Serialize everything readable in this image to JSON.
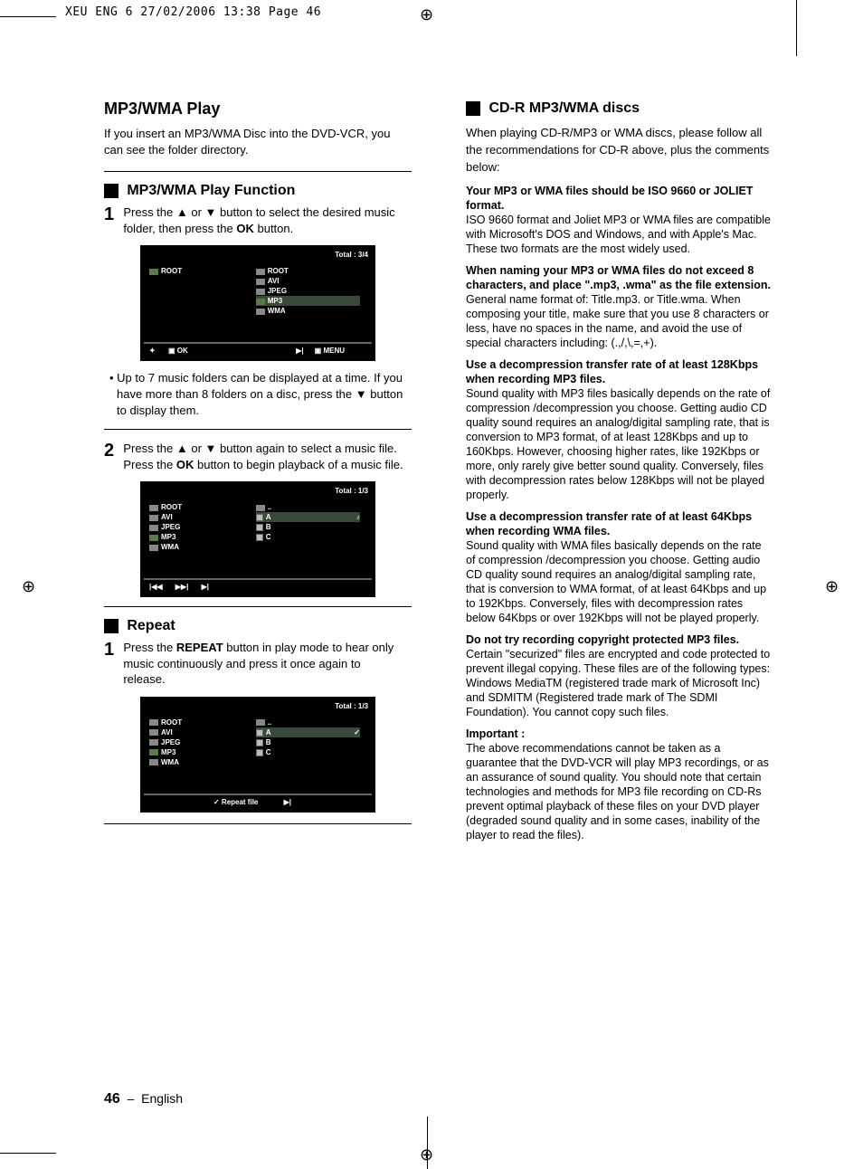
{
  "header": {
    "text": "XEU ENG 6  27/02/2006  13:38  Page 46"
  },
  "left": {
    "title": "MP3/WMA Play",
    "intro": "If you insert an MP3/WMA Disc into the DVD-VCR, you can see the folder directory.",
    "section1": {
      "title": "MP3/WMA Play Function",
      "step1_a": "Press the ▲ or ▼ button to select the desired music folder, then press the ",
      "step1_ok": "OK",
      "step1_b": " button.",
      "bullet": "• Up to 7 music folders can be displayed at a time. If you have more than 8 folders on a disc, press the ▼ button to display them.",
      "step2_a": "Press the ▲ or ▼ button again to select a music file. Press the ",
      "step2_ok": "OK",
      "step2_b": " button to begin playback of a music file."
    },
    "section2": {
      "title": "Repeat",
      "step1_a": "Press the ",
      "step1_repeat": "REPEAT",
      "step1_b": " button in play mode to hear only music continuously and press it once again to release."
    },
    "osd1": {
      "total": "Total : 3/4",
      "left_items": [
        "ROOT"
      ],
      "right_items": [
        "ROOT",
        "AVI",
        "JPEG",
        "MP3",
        "WMA"
      ],
      "selected": "MP3",
      "footer": {
        "ok": "OK",
        "menu": "MENU"
      }
    },
    "osd2": {
      "total": "Total : 1/3",
      "left_items": [
        "ROOT",
        "AVI",
        "JPEG",
        "MP3",
        "WMA"
      ],
      "left_sel": "MP3",
      "right_items": [
        "..",
        "A",
        "B",
        "C"
      ],
      "right_sel": "A"
    },
    "osd3": {
      "total": "Total : 1/3",
      "left_items": [
        "ROOT",
        "AVI",
        "JPEG",
        "MP3",
        "WMA"
      ],
      "left_sel": "MP3",
      "right_items": [
        "..",
        "A",
        "B",
        "C"
      ],
      "right_sel": "A",
      "footer": "✓ Repeat file"
    }
  },
  "right": {
    "title": "CD-R MP3/WMA discs",
    "intro": "When playing CD-R/MP3 or WMA discs, please follow all the recommendations for CD-R above, plus the comments below:",
    "b1_title": "Your MP3 or WMA files should be ISO 9660 or JOLIET format.",
    "b1_body": "ISO 9660 format and Joliet MP3 or WMA files are compatible with Microsoft's DOS and Windows, and with Apple's Mac. These two formats are the most widely used.",
    "b2_title": "When naming your MP3 or WMA files do not exceed 8 characters, and place \".mp3, .wma\" as the file extension.",
    "b2_body": "General name format of: Title.mp3. or Title.wma. When composing your title, make sure that you use 8 characters or less, have no spaces in the name, and avoid the use of special characters including: (.,/,\\,=,+).",
    "b3_title": "Use a decompression transfer rate of at least 128Kbps when recording MP3 files.",
    "b3_body": "Sound quality with MP3 files basically depends on the rate of compression /decompression you choose. Getting audio CD quality sound requires an analog/digital sampling rate, that is conversion to MP3 format, of at least 128Kbps and up to 160Kbps. However, choosing higher rates, like 192Kbps or more, only rarely give better sound quality. Conversely, files with decompression rates below 128Kbps will not be played properly.",
    "b4_title": "Use a decompression transfer rate of at least 64Kbps when recording WMA files.",
    "b4_body": "Sound quality with WMA files basically depends on the rate of compression /decompression you choose. Getting audio CD quality sound requires an analog/digital sampling rate, that is conversion to WMA format, of at least 64Kbps and up to 192Kbps. Conversely, files with decompression rates below 64Kbps or over 192Kbps will not be played properly.",
    "b5_title": "Do not try recording copyright protected MP3 files.",
    "b5_body": "Certain \"securized\" files are encrypted and code protected to prevent illegal copying. These files are of the following types: Windows MediaTM (registered trade mark of Microsoft Inc) and SDMITM (Registered trade mark of The SDMI Foundation). You cannot copy such files.",
    "b6_title": "Important :",
    "b6_body": "The above recommendations cannot be taken as a guarantee that the DVD-VCR will play MP3 recordings, or as an assurance of sound quality. You should note that certain technologies and methods for MP3 file recording on CD-Rs prevent optimal playback of these files on your DVD player (degraded sound quality and in some cases, inability of the player to read the files)."
  },
  "footer": {
    "num": "46",
    "sep": "–",
    "lang": "English"
  }
}
